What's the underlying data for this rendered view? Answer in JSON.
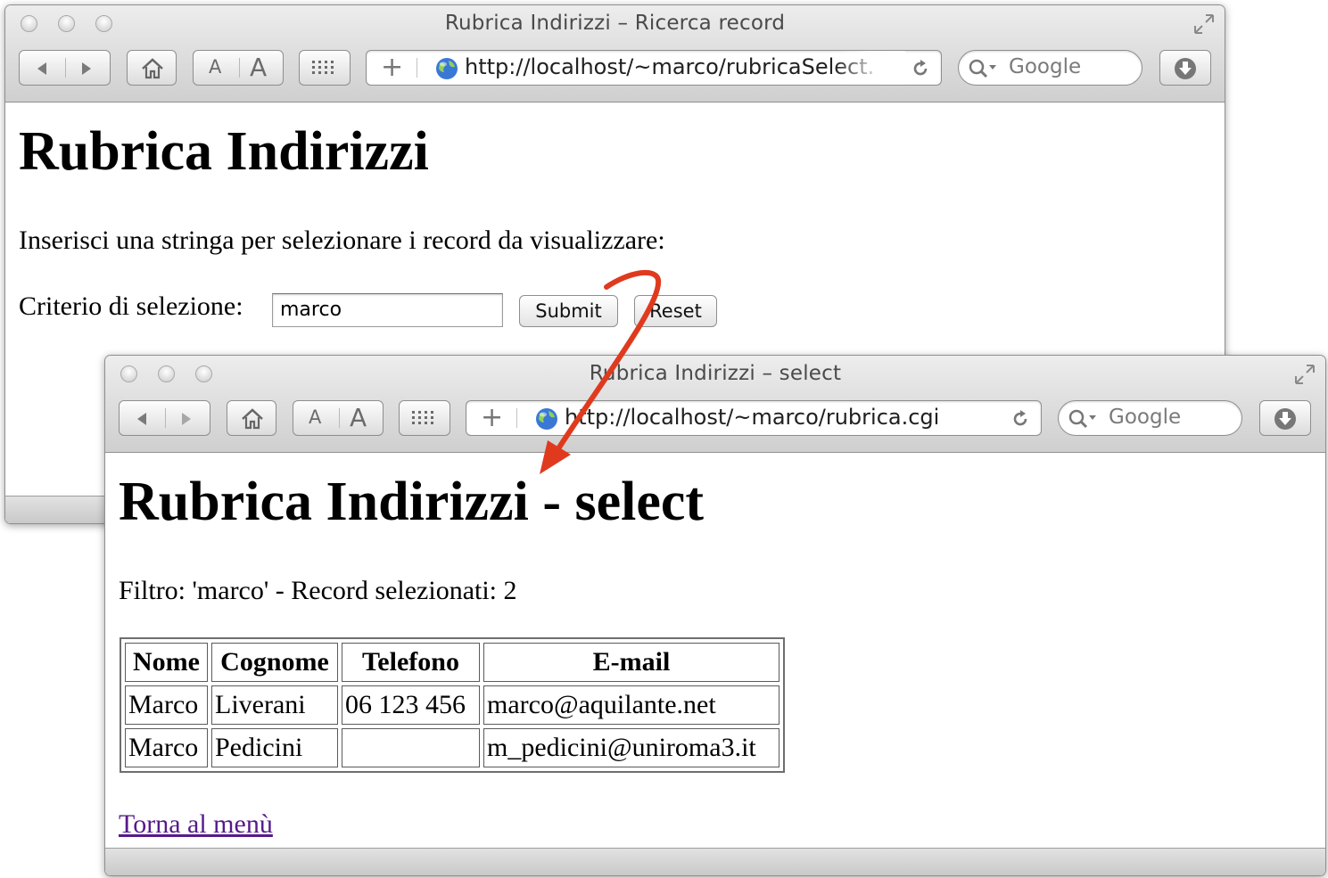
{
  "window1": {
    "title": "Rubrica Indirizzi – Ricerca record",
    "url": "http://localhost/~marco/rubricaSelect.",
    "search_placeholder": "Google",
    "heading": "Rubrica Indirizzi",
    "instruction": "Inserisci una stringa per selezionare i record da visualizzare:",
    "criterio_label": "Criterio di selezione:",
    "criterio_value": "marco",
    "submit_label": "Submit",
    "reset_label": "Reset",
    "icons": [
      "back-icon",
      "forward-icon",
      "home-icon",
      "text-smaller-icon",
      "text-larger-icon",
      "top-sites-icon",
      "add-bookmark-icon",
      "globe-icon",
      "reload-icon",
      "search-icon",
      "download-icon",
      "resize-icon"
    ]
  },
  "window2": {
    "title": "Rubrica Indirizzi – select",
    "url": "http://localhost/~marco/rubrica.cgi",
    "search_placeholder": "Google",
    "heading": "Rubrica Indirizzi - select",
    "filter_text": "Filtro: 'marco' - Record selezionati: 2",
    "table": {
      "headers": [
        "Nome",
        "Cognome",
        "Telefono",
        "E-mail"
      ],
      "rows": [
        [
          "Marco",
          "Liverani",
          "06 123 456",
          "marco@aquilante.net"
        ],
        [
          "Marco",
          "Pedicini",
          "",
          "m_pedicini@uniroma3.it"
        ]
      ]
    },
    "back_link": "Torna al menù"
  },
  "colors": {
    "arrow": "#e03a1e",
    "link": "#551a8b",
    "chrome": "#d6d6d6"
  }
}
